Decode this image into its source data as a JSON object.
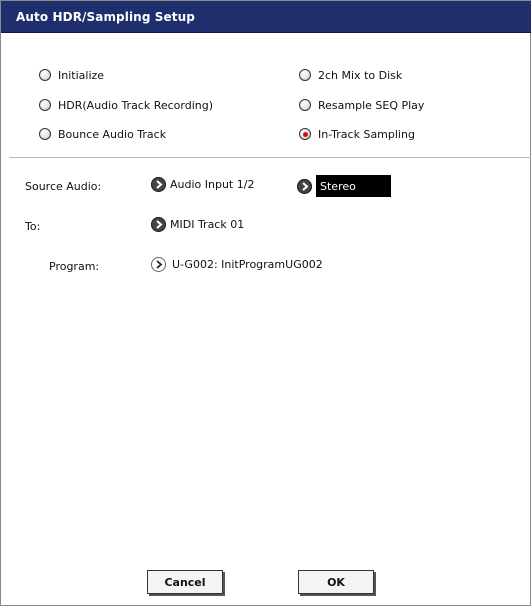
{
  "dialog": {
    "title": "Auto HDR/Sampling Setup"
  },
  "modes": [
    {
      "label": "Initialize",
      "selected": false
    },
    {
      "label": "2ch Mix to Disk",
      "selected": false
    },
    {
      "label": "HDR(Audio Track Recording)",
      "selected": false
    },
    {
      "label": "Resample SEQ Play",
      "selected": false
    },
    {
      "label": "Bounce Audio Track",
      "selected": false
    },
    {
      "label": "In-Track Sampling",
      "selected": true
    }
  ],
  "source_audio": {
    "label": "Source Audio:",
    "input": "Audio Input 1/2",
    "mode": "Stereo"
  },
  "to": {
    "label": "To:",
    "value": "MIDI Track 01"
  },
  "program": {
    "label": "Program:",
    "value": "U-G002: InitProgramUG002"
  },
  "buttons": {
    "cancel": "Cancel",
    "ok": "OK"
  },
  "colors": {
    "titlebar": "#1f2f6e",
    "radio_selected": "#cc1414",
    "value_box": "#000000"
  }
}
